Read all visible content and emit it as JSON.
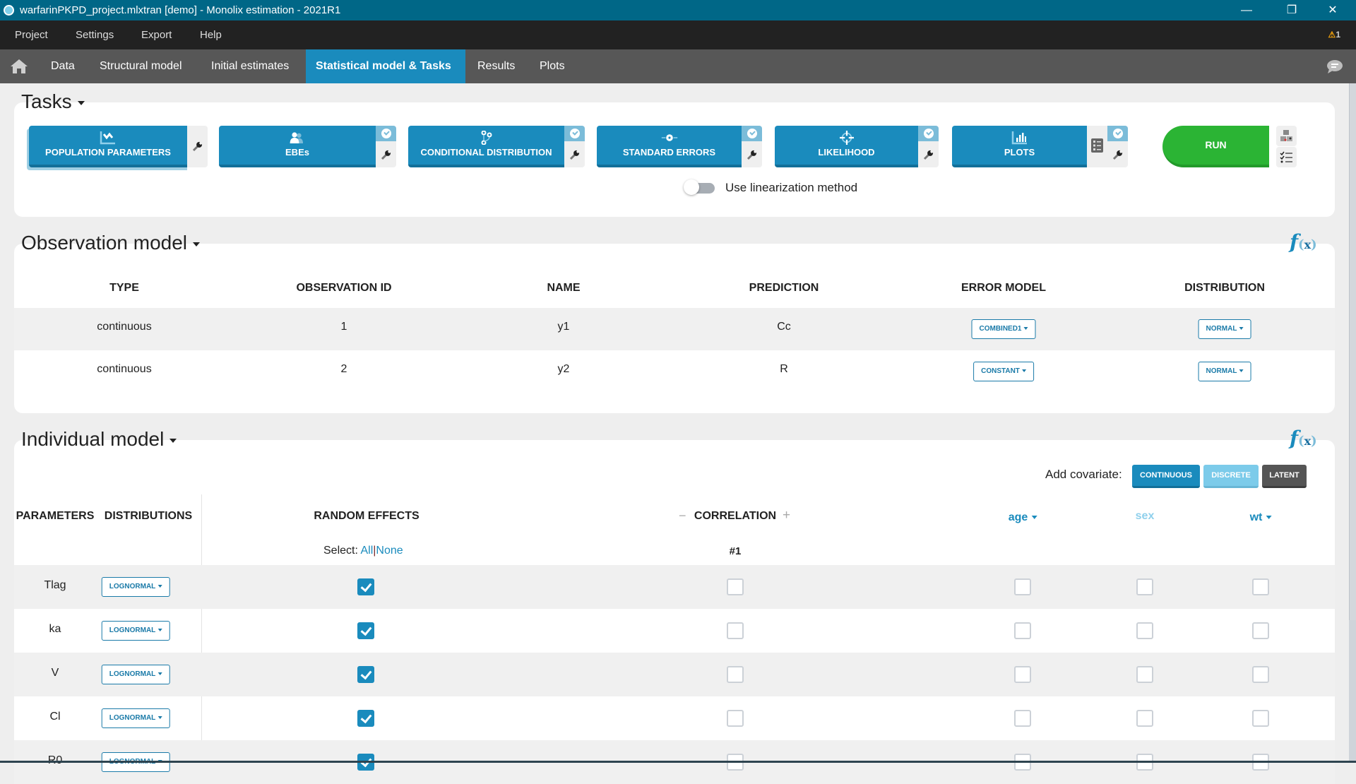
{
  "window": {
    "title": "warfarinPKPD_project.mlxtran [demo]  - Monolix estimation - 2021R1",
    "controls": {
      "minimize": "—",
      "maximize": "❐",
      "close": "✕"
    }
  },
  "menu": {
    "items": [
      "Project",
      "Settings",
      "Export",
      "Help"
    ],
    "warning_count": "1"
  },
  "tabs": {
    "items": [
      {
        "label": "Data",
        "active": false
      },
      {
        "label": "Structural model",
        "active": false
      },
      {
        "label": "Initial estimates",
        "active": false
      },
      {
        "label": "Statistical model & Tasks",
        "active": true
      },
      {
        "label": "Results",
        "active": false
      },
      {
        "label": "Plots",
        "active": false
      }
    ]
  },
  "tasks": {
    "heading": "Tasks",
    "buttons": [
      {
        "label": "POPULATION PARAMETERS",
        "icon": "population-parameters-icon",
        "checked": false,
        "selected": true
      },
      {
        "label": "EBEs",
        "icon": "ebes-users-icon",
        "checked": true
      },
      {
        "label": "CONDITIONAL DISTRIBUTION",
        "icon": "conditional-distribution-icon",
        "checked": true
      },
      {
        "label": "STANDARD ERRORS",
        "icon": "standard-errors-icon",
        "checked": true
      },
      {
        "label": "LIKELIHOOD",
        "icon": "likelihood-crosshair-icon",
        "checked": true
      },
      {
        "label": "PLOTS",
        "icon": "plots-bar-chart-icon",
        "checked": true
      }
    ],
    "run_label": "RUN",
    "linearization": {
      "label": "Use linearization method",
      "enabled": false
    }
  },
  "observation_model": {
    "heading": "Observation model",
    "columns": [
      "TYPE",
      "OBSERVATION ID",
      "NAME",
      "PREDICTION",
      "ERROR MODEL",
      "DISTRIBUTION"
    ],
    "rows": [
      {
        "type": "continuous",
        "id": "1",
        "name": "y1",
        "prediction": "Cc",
        "error_model": "COMBINED1",
        "distribution": "NORMAL"
      },
      {
        "type": "continuous",
        "id": "2",
        "name": "y2",
        "prediction": "R",
        "error_model": "CONSTANT",
        "distribution": "NORMAL"
      }
    ]
  },
  "individual_model": {
    "heading": "Individual model",
    "add_covariate_label": "Add covariate:",
    "covariate_buttons": {
      "continuous": "CONTINUOUS",
      "discrete": "DISCRETE",
      "latent": "LATENT"
    },
    "columns": {
      "parameters": "PARAMETERS",
      "distributions": "DISTRIBUTIONS",
      "random_effects": "RANDOM EFFECTS",
      "correlation": "CORRELATION",
      "correlation_minus": "−",
      "correlation_plus": "+",
      "correlation_group": "#1"
    },
    "select": {
      "label": "Select:",
      "all": "All",
      "sep": "|",
      "none": "None"
    },
    "covariates": [
      "age",
      "sex",
      "wt"
    ],
    "rows": [
      {
        "param": "Tlag",
        "distribution": "LOGNORMAL",
        "random_effect": true,
        "correlation": false,
        "age": false,
        "sex": false,
        "wt": false
      },
      {
        "param": "ka",
        "distribution": "LOGNORMAL",
        "random_effect": true,
        "correlation": false,
        "age": false,
        "sex": false,
        "wt": false
      },
      {
        "param": "V",
        "distribution": "LOGNORMAL",
        "random_effect": true,
        "correlation": false,
        "age": false,
        "sex": false,
        "wt": false
      },
      {
        "param": "Cl",
        "distribution": "LOGNORMAL",
        "random_effect": true,
        "correlation": false,
        "age": false,
        "sex": false,
        "wt": false
      },
      {
        "param": "R0",
        "distribution": "LOGNORMAL",
        "random_effect": true,
        "correlation": false,
        "age": false,
        "sex": false,
        "wt": false
      }
    ]
  },
  "colors": {
    "primary": "#1a8bbd",
    "run": "#2bb434",
    "titlebar": "#006787",
    "menubar": "#222222",
    "tabbar": "#575757",
    "warning": "#f2a20c"
  }
}
